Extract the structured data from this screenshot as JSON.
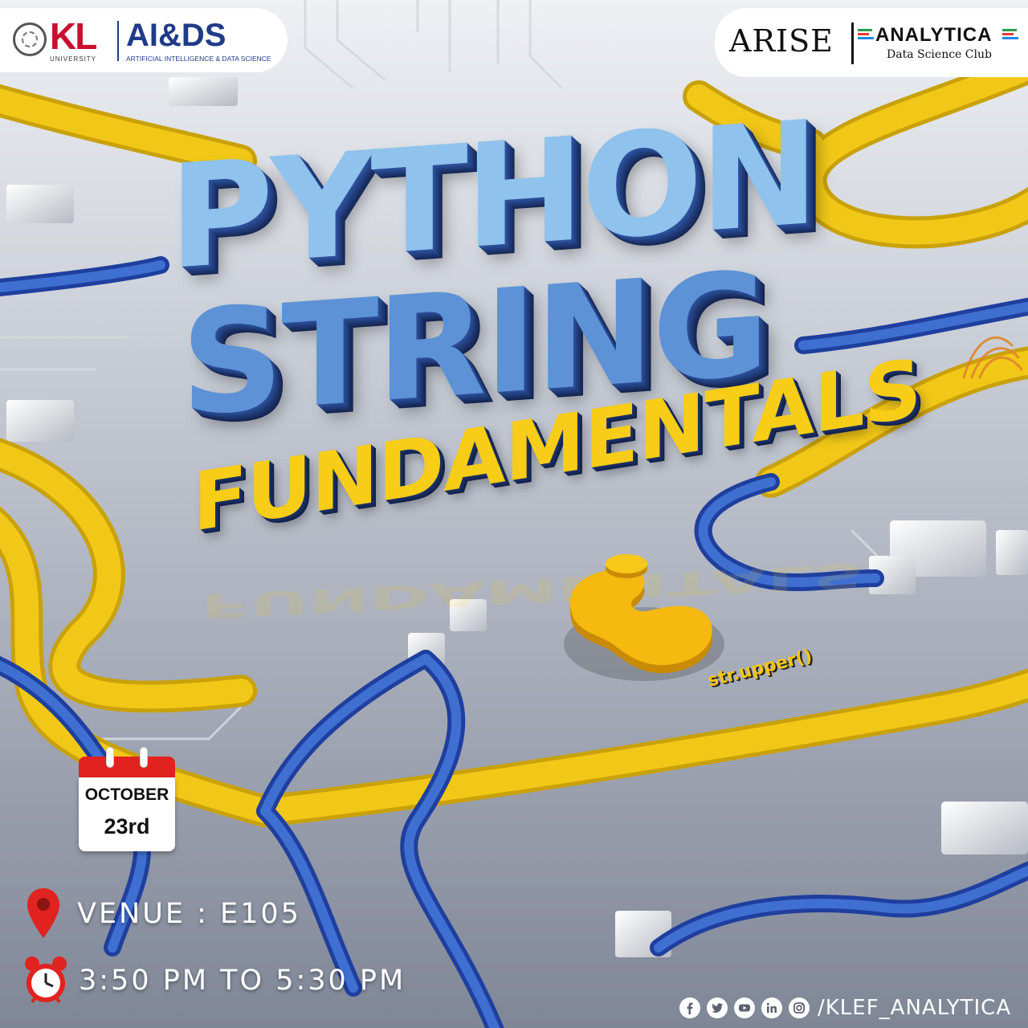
{
  "header": {
    "left_logo": {
      "brand": "KL",
      "brand_sub": "UNIVERSITY",
      "department": "AI&DS",
      "department_sub": "ARTIFICIAL INTELLIGENCE & DATA SCIENCE"
    },
    "right_logo": {
      "club_a": "ARISE",
      "club_b": "ANALYTICA",
      "club_b_sub": "Data Science Club"
    }
  },
  "title": {
    "line1": "PYTHON",
    "line2": "STRING",
    "line3": "FUNDAMENTALS"
  },
  "code_label": "str.upper()",
  "event": {
    "month": "OCTOBER",
    "day": "23rd",
    "venue": "VENUE : E105",
    "time": "3:50 PM TO 5:30 PM"
  },
  "social": {
    "icons": [
      "facebook-icon",
      "twitter-icon",
      "youtube-icon",
      "linkedin-icon",
      "instagram-icon"
    ],
    "handle": "/KLEF_ANALYTICA"
  },
  "colors": {
    "accent_yellow": "#f7cd17",
    "accent_blue": "#2c4f9a",
    "light_blue": "#8fc2ec",
    "kl_red": "#c8102e"
  }
}
